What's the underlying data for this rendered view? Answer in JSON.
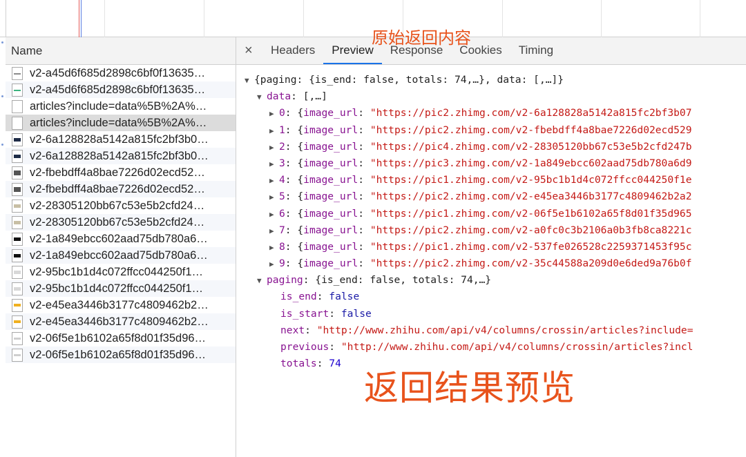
{
  "name_panel": {
    "header": "Name",
    "requests": [
      {
        "name": "v2-a45d6f685d2898c6bf0f13635…",
        "icon": "doc"
      },
      {
        "name": "v2-a45d6f685d2898c6bf0f13635…",
        "icon": "green"
      },
      {
        "name": "articles?include=data%5B%2A%…",
        "icon": "blank"
      },
      {
        "name": "articles?include=data%5B%2A%…",
        "icon": "blank"
      },
      {
        "name": "v2-6a128828a5142a815fc2bf3b0…",
        "icon": "dark"
      },
      {
        "name": "v2-6a128828a5142a815fc2bf3b0…",
        "icon": "dark"
      },
      {
        "name": "v2-fbebdff4a8bae7226d02ecd52…",
        "icon": "photo"
      },
      {
        "name": "v2-fbebdff4a8bae7226d02ecd52…",
        "icon": "photo"
      },
      {
        "name": "v2-28305120bb67c53e5b2cfd24…",
        "icon": "tan"
      },
      {
        "name": "v2-28305120bb67c53e5b2cfd24…",
        "icon": "tan"
      },
      {
        "name": "v2-1a849ebcc602aad75db780a6…",
        "icon": "black"
      },
      {
        "name": "v2-1a849ebcc602aad75db780a6…",
        "icon": "black"
      },
      {
        "name": "v2-95bc1b1d4c072ffcc044250f1…",
        "icon": "light"
      },
      {
        "name": "v2-95bc1b1d4c072ffcc044250f1…",
        "icon": "light"
      },
      {
        "name": "v2-e45ea3446b3177c4809462b2…",
        "icon": "yellow"
      },
      {
        "name": "v2-e45ea3446b3177c4809462b2…",
        "icon": "yellow"
      },
      {
        "name": "v2-06f5e1b6102a65f8d01f35d96…",
        "icon": "faint"
      },
      {
        "name": "v2-06f5e1b6102a65f8d01f35d96…",
        "icon": "faint"
      }
    ]
  },
  "tabs": {
    "close": "×",
    "items": [
      {
        "label": "Headers",
        "active": false
      },
      {
        "label": "Preview",
        "active": true
      },
      {
        "label": "Response",
        "active": false
      },
      {
        "label": "Cookies",
        "active": false
      },
      {
        "label": "Timing",
        "active": false
      }
    ]
  },
  "preview": {
    "root_line": "{paging: {is_end: false, totals: 74,…}, data: [,…]}",
    "data_key": "data",
    "data_summary": "[,…]",
    "items": [
      {
        "index": "0",
        "url": "\"https://pic2.zhimg.com/v2-6a128828a5142a815fc2bf3b07"
      },
      {
        "index": "1",
        "url": "\"https://pic2.zhimg.com/v2-fbebdff4a8bae7226d02ecd529"
      },
      {
        "index": "2",
        "url": "\"https://pic4.zhimg.com/v2-28305120bb67c53e5b2cfd247b"
      },
      {
        "index": "3",
        "url": "\"https://pic3.zhimg.com/v2-1a849ebcc602aad75db780a6d9"
      },
      {
        "index": "4",
        "url": "\"https://pic1.zhimg.com/v2-95bc1b1d4c072ffcc044250f1e"
      },
      {
        "index": "5",
        "url": "\"https://pic2.zhimg.com/v2-e45ea3446b3177c4809462b2a2"
      },
      {
        "index": "6",
        "url": "\"https://pic1.zhimg.com/v2-06f5e1b6102a65f8d01f35d965"
      },
      {
        "index": "7",
        "url": "\"https://pic2.zhimg.com/v2-a0fc0c3b2106a0b3fb8ca8221c"
      },
      {
        "index": "8",
        "url": "\"https://pic1.zhimg.com/v2-537fe026528c2259371453f95c"
      },
      {
        "index": "9",
        "url": "\"https://pic2.zhimg.com/v2-35c44588a209d0e6ded9a76b0f"
      }
    ],
    "item_key": "image_url",
    "paging_key": "paging",
    "paging_summary": "{is_end: false, totals: 74,…}",
    "paging_fields": [
      {
        "key": "is_end",
        "value": "false",
        "kind": "kw"
      },
      {
        "key": "is_start",
        "value": "false",
        "kind": "kw"
      },
      {
        "key": "next",
        "value": "\"http://www.zhihu.com/api/v4/columns/crossin/articles?include=",
        "kind": "str"
      },
      {
        "key": "previous",
        "value": "\"http://www.zhihu.com/api/v4/columns/crossin/articles?incl",
        "kind": "str"
      },
      {
        "key": "totals",
        "value": "74",
        "kind": "num"
      }
    ]
  },
  "annotations": {
    "top": "原始返回内容",
    "bottom": "返回结果预览"
  },
  "colors": {
    "annotation": "#e8531c",
    "active_tab_underline": "#1a73e8",
    "json_key": "#881391",
    "json_string": "#c41a16"
  }
}
